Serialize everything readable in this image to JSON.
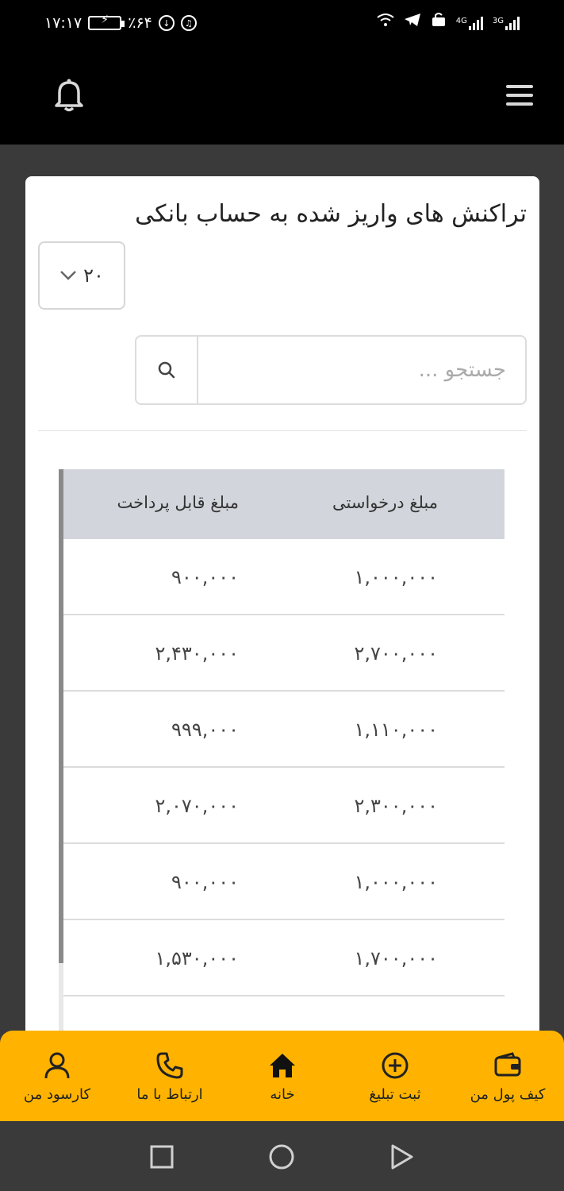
{
  "status_bar": {
    "time": "۱۷:۱۷",
    "battery_percent": "٪۶۴",
    "network_1": "4G",
    "network_2": "3G"
  },
  "page": {
    "title": "تراکنش های واریز شده به حساب بانکی"
  },
  "controls": {
    "per_page": "۲۰",
    "search_placeholder": "جستجو ..."
  },
  "table": {
    "columns": [
      "مبلغ درخواستی",
      "مبلغ قابل پرداخت"
    ],
    "rows": [
      {
        "requested": "۱,۰۰۰,۰۰۰",
        "payable": "۹۰۰,۰۰۰"
      },
      {
        "requested": "۲,۷۰۰,۰۰۰",
        "payable": "۲,۴۳۰,۰۰۰"
      },
      {
        "requested": "۱,۱۱۰,۰۰۰",
        "payable": "۹۹۹,۰۰۰"
      },
      {
        "requested": "۲,۳۰۰,۰۰۰",
        "payable": "۲,۰۷۰,۰۰۰"
      },
      {
        "requested": "۱,۰۰۰,۰۰۰",
        "payable": "۹۰۰,۰۰۰"
      },
      {
        "requested": "۱,۷۰۰,۰۰۰",
        "payable": "۱,۵۳۰,۰۰۰"
      }
    ]
  },
  "bottom_nav": {
    "items": [
      {
        "label": "کیف پول من",
        "icon": "wallet-icon"
      },
      {
        "label": "ثبت تبلیغ",
        "icon": "plus-circle-icon"
      },
      {
        "label": "خانه",
        "icon": "home-icon"
      },
      {
        "label": "ارتباط با ما",
        "icon": "phone-icon"
      },
      {
        "label": "کارسود من",
        "icon": "user-icon"
      }
    ]
  },
  "colors": {
    "accent": "#ffb300",
    "header_bg": "#000000",
    "page_bg": "#3a3a3a",
    "table_header_bg": "#d2d6dc"
  }
}
